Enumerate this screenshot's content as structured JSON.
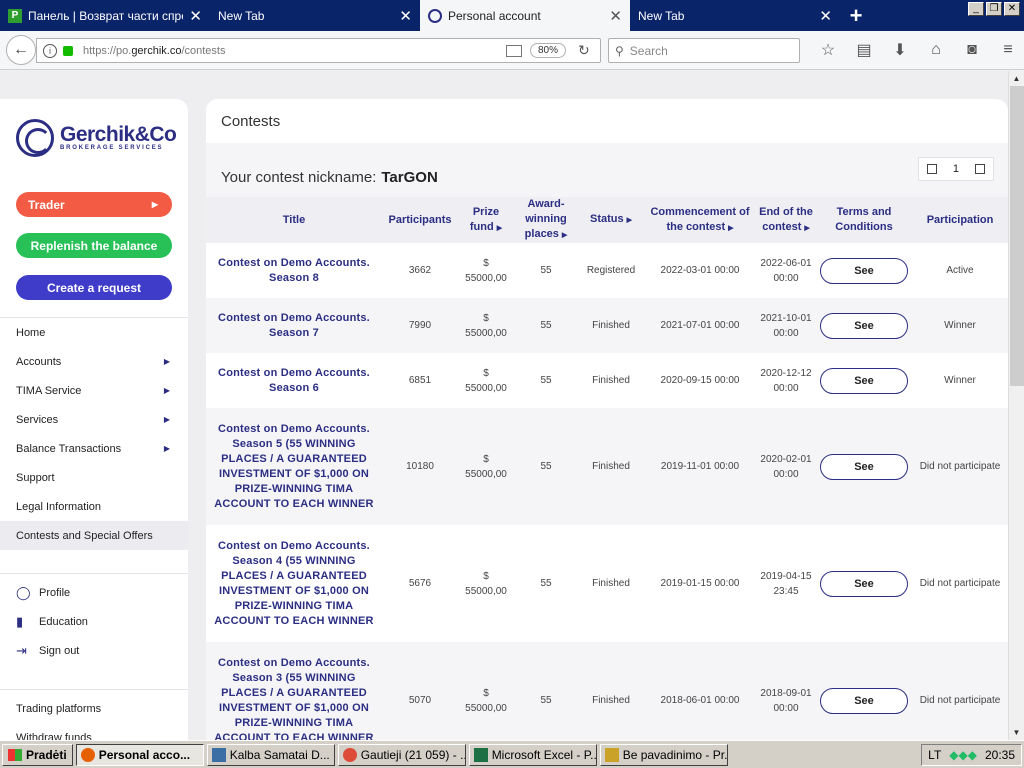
{
  "browser": {
    "tabs": [
      {
        "title": "Панель | Возврат части спре...",
        "active": false
      },
      {
        "title": "New Tab",
        "active": false
      },
      {
        "title": "Personal account",
        "active": true
      },
      {
        "title": "New Tab",
        "active": false
      }
    ],
    "url_prefix": "https://po.",
    "url_domain": "gerchik.co",
    "url_path": "/contests",
    "zoom": "80%",
    "search_placeholder": "Search"
  },
  "logo": {
    "name": "Gerchik&Co",
    "tagline": "BROKERAGE SERVICES"
  },
  "sidebar": {
    "trader_button": "Trader",
    "replenish_button": "Replenish the balance",
    "request_button": "Create a request",
    "menu": [
      {
        "label": "Home",
        "has_submenu": false,
        "selected": false
      },
      {
        "label": "Accounts",
        "has_submenu": true,
        "selected": false
      },
      {
        "label": "TIMA Service",
        "has_submenu": true,
        "selected": false
      },
      {
        "label": "Services",
        "has_submenu": true,
        "selected": false
      },
      {
        "label": "Balance Transactions",
        "has_submenu": true,
        "selected": false
      },
      {
        "label": "Support",
        "has_submenu": false,
        "selected": false
      },
      {
        "label": "Legal Information",
        "has_submenu": false,
        "selected": false
      },
      {
        "label": "Contests and Special Offers",
        "has_submenu": false,
        "selected": true
      }
    ],
    "account_menu": [
      {
        "label": "Profile",
        "icon": "user-icon"
      },
      {
        "label": "Education",
        "icon": "book-icon"
      },
      {
        "label": "Sign out",
        "icon": "sign-out-icon"
      }
    ],
    "bottom_menu": [
      "Trading platforms",
      "Withdraw funds"
    ]
  },
  "main": {
    "page_title": "Contests",
    "nickname_label": "Your contest nickname:",
    "nickname": "TarGON",
    "current_page": "1",
    "columns": [
      "Title",
      "Participants",
      "Prize fund",
      "Award-winning places",
      "Status",
      "Commencement of the contest",
      "End of the contest",
      "Terms and Conditions",
      "Participation"
    ],
    "rows": [
      {
        "title": "Contest on Demo Accounts. Season 8",
        "participants": "3662",
        "prize": "$ 55000,00",
        "places": "55",
        "status": "Registered",
        "start": "2022-03-01 00:00",
        "end": "2022-06-01 00:00",
        "terms": "See",
        "participation": "Active"
      },
      {
        "title": "Contest on Demo Accounts. Season 7",
        "participants": "7990",
        "prize": "$ 55000,00",
        "places": "55",
        "status": "Finished",
        "start": "2021-07-01 00:00",
        "end": "2021-10-01 00:00",
        "terms": "See",
        "participation": "Winner"
      },
      {
        "title": "Contest on Demo Accounts. Season 6",
        "participants": "6851",
        "prize": "$ 55000,00",
        "places": "55",
        "status": "Finished",
        "start": "2020-09-15 00:00",
        "end": "2020-12-12 00:00",
        "terms": "See",
        "participation": "Winner"
      },
      {
        "title": "Contest on Demo Accounts. Season 5 (55 WINNING PLACES / A GUARANTEED INVESTMENT OF $1,000 ON PRIZE-WINNING TIMA ACCOUNT TO EACH WINNER",
        "participants": "10180",
        "prize": "$ 55000,00",
        "places": "55",
        "status": "Finished",
        "start": "2019-11-01 00:00",
        "end": "2020-02-01 00:00",
        "terms": "See",
        "participation": "Did not participate"
      },
      {
        "title": "Contest on Demo Accounts. Season 4 (55 WINNING PLACES / A GUARANTEED INVESTMENT OF $1,000 ON PRIZE-WINNING TIMA ACCOUNT TO EACH WINNER",
        "participants": "5676",
        "prize": "$ 55000,00",
        "places": "55",
        "status": "Finished",
        "start": "2019-01-15 00:00",
        "end": "2019-04-15 23:45",
        "terms": "See",
        "participation": "Did not participate"
      },
      {
        "title": "Contest on Demo Accounts. Season 3 (55 WINNING PLACES / A GUARANTEED INVESTMENT OF $1,000 ON PRIZE-WINNING TIMA ACCOUNT TO EACH WINNER",
        "participants": "5070",
        "prize": "$ 55000,00",
        "places": "55",
        "status": "Finished",
        "start": "2018-06-01 00:00",
        "end": "2018-09-01 00:00",
        "terms": "See",
        "participation": "Did not participate"
      }
    ]
  },
  "taskbar": {
    "start": "Pradėti",
    "items": [
      {
        "label": "Personal acco...",
        "active": true
      },
      {
        "label": "Kalba Samatai  D...",
        "active": false
      },
      {
        "label": "Gautieji (21 059) - ...",
        "active": false
      },
      {
        "label": "Microsoft Excel - P...",
        "active": false
      },
      {
        "label": "Be pavadinimo - Pr...",
        "active": false
      }
    ],
    "lang": "LT",
    "clock": "20:35"
  },
  "colors": {
    "brand": "#2b2e83",
    "trader": "#f35b44",
    "replenish": "#27c157",
    "request": "#3e3cc8",
    "titlebar": "#0a246a"
  }
}
